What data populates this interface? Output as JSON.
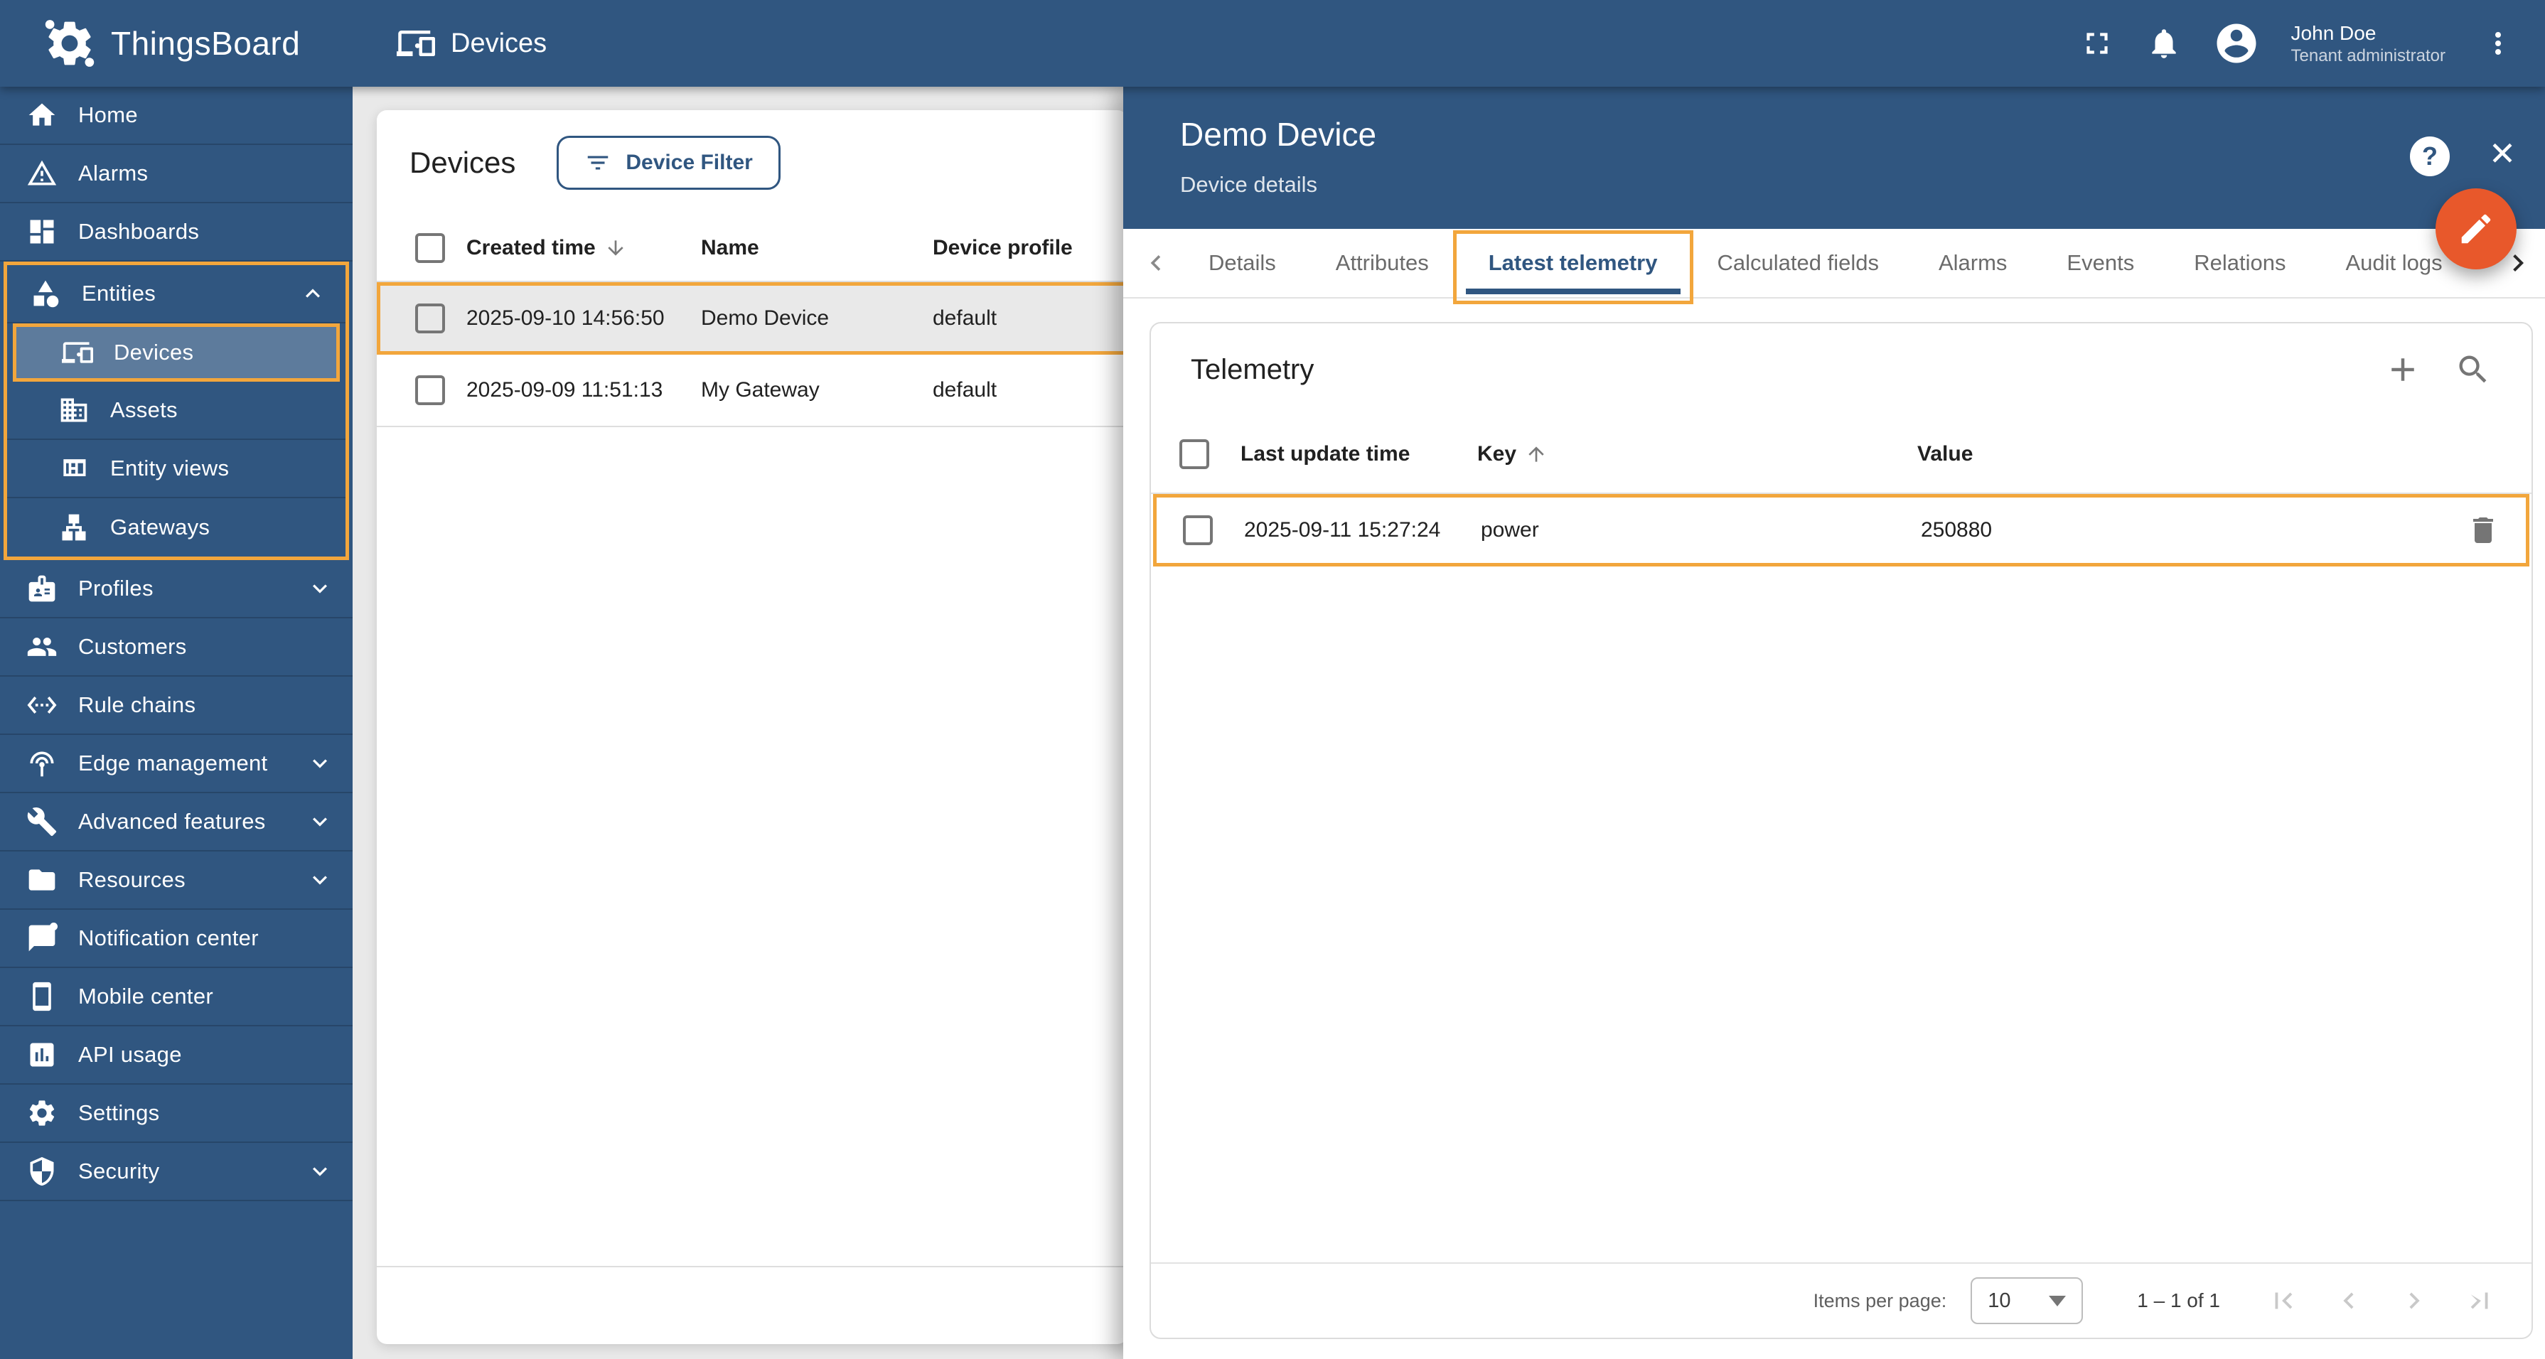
{
  "colors": {
    "primary": "#305680",
    "accent_fab": "#E8582B",
    "annotation_highlight": "#F2A63C"
  },
  "topbar": {
    "brand": "ThingsBoard",
    "page": {
      "icon": "devices",
      "title": "Devices"
    },
    "user": {
      "name": "John Doe",
      "role": "Tenant administrator"
    },
    "icons": {
      "fullscreen": "fullscreen-icon",
      "notifications": "bell-icon",
      "account": "account-circle-icon",
      "menu": "kebab-menu-icon"
    }
  },
  "sidebar": {
    "items": [
      {
        "label": "Home",
        "icon": "home"
      },
      {
        "label": "Alarms",
        "icon": "warning-triangle"
      },
      {
        "label": "Dashboards",
        "icon": "dashboard-grid"
      },
      {
        "label": "Entities",
        "icon": "category-shapes",
        "expanded": true
      },
      {
        "label": "Devices",
        "icon": "devices",
        "selected": true,
        "parent": "Entities"
      },
      {
        "label": "Assets",
        "icon": "building",
        "parent": "Entities"
      },
      {
        "label": "Entity views",
        "icon": "view-quilt",
        "parent": "Entities"
      },
      {
        "label": "Gateways",
        "icon": "lan-hierarchy",
        "parent": "Entities"
      },
      {
        "label": "Profiles",
        "icon": "badge",
        "expandable": true
      },
      {
        "label": "Customers",
        "icon": "people"
      },
      {
        "label": "Rule chains",
        "icon": "code-arrows"
      },
      {
        "label": "Edge management",
        "icon": "antenna",
        "expandable": true
      },
      {
        "label": "Advanced features",
        "icon": "tools",
        "expandable": true
      },
      {
        "label": "Resources",
        "icon": "folder",
        "expandable": true
      },
      {
        "label": "Notification center",
        "icon": "chat-bubble"
      },
      {
        "label": "Mobile center",
        "icon": "smartphone"
      },
      {
        "label": "API usage",
        "icon": "bar-chart"
      },
      {
        "label": "Settings",
        "icon": "gear"
      },
      {
        "label": "Security",
        "icon": "shield",
        "expandable": true
      }
    ]
  },
  "devices_panel": {
    "title": "Devices",
    "filter_button_label": "Device Filter",
    "columns": {
      "created": "Created time",
      "name": "Name",
      "profile": "Device profile"
    },
    "sort": {
      "column": "Created time",
      "direction": "desc"
    },
    "rows": [
      {
        "created_time": "2025-09-10 14:56:50",
        "name": "Demo Device",
        "device_profile": "default",
        "highlighted": true
      },
      {
        "created_time": "2025-09-09 11:51:13",
        "name": "My Gateway",
        "device_profile": "default",
        "highlighted": false
      }
    ]
  },
  "drawer": {
    "title": "Demo Device",
    "subtitle": "Device details",
    "help_label": "?",
    "close_label": "✕",
    "tabs": [
      "Details",
      "Attributes",
      "Latest telemetry",
      "Calculated fields",
      "Alarms",
      "Events",
      "Relations",
      "Audit logs"
    ],
    "active_tab": "Latest telemetry",
    "telemetry": {
      "title": "Telemetry",
      "columns": {
        "time": "Last update time",
        "key": "Key",
        "value": "Value"
      },
      "sort": {
        "column": "Key",
        "direction": "asc"
      },
      "rows": [
        {
          "last_update_time": "2025-09-11 15:27:24",
          "key": "power",
          "value": "250880"
        }
      ],
      "pagination": {
        "items_per_page_label": "Items per page:",
        "items_per_page": "10",
        "range": "1 – 1 of 1"
      }
    }
  }
}
